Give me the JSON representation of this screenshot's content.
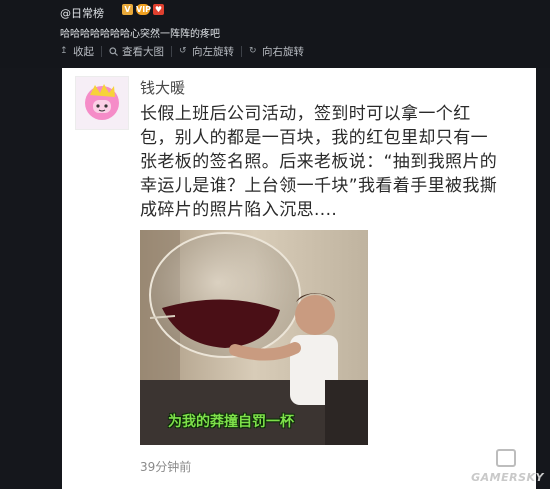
{
  "header": {
    "username": "@日常榜",
    "badges": [
      "V",
      "VIP",
      "♥"
    ],
    "caption": "哈哈哈哈哈哈哈心突然一阵阵的疼吧"
  },
  "toolbar": {
    "collapse_label": "收起",
    "view_large_label": "查看大图",
    "rotate_left_label": "向左旋转",
    "rotate_right_label": "向右旋转"
  },
  "post": {
    "author": "钱大暖",
    "text": "长假上班后公司活动，签到时可以拿一个红包，别人的都是一百块，我的红包里却只有一张老板的签名照。后来老板说：“抽到我照片的幸运儿是谁？上台领一千块”我看着手里被我撕成碎片的照片陷入沉思....",
    "photo_caption": "为我的莽撞自罚一杯",
    "timestamp": "39分钟前"
  },
  "watermark": "GAMERSKY",
  "colors": {
    "background": "#15171c",
    "card": "#ffffff",
    "caption_green": "#7ee04a"
  }
}
